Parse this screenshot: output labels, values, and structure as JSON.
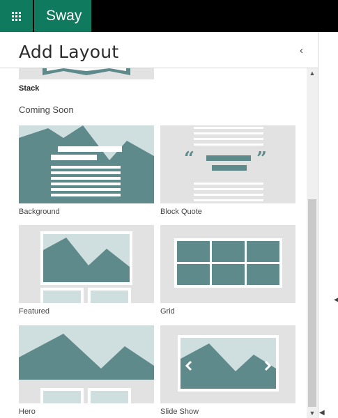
{
  "app": {
    "name": "Sway",
    "accent": "#0f7a5e"
  },
  "panel": {
    "title": "Add Layout",
    "collapse_icon": "‹"
  },
  "previous": {
    "label": "Stack"
  },
  "section": {
    "heading": "Coming Soon"
  },
  "layouts": [
    {
      "label": "Background",
      "icon": "background-layout-icon"
    },
    {
      "label": "Block Quote",
      "icon": "block-quote-layout-icon"
    },
    {
      "label": "Featured",
      "icon": "featured-layout-icon"
    },
    {
      "label": "Grid",
      "icon": "grid-layout-icon"
    },
    {
      "label": "Hero",
      "icon": "hero-layout-icon"
    },
    {
      "label": "Slide Show",
      "icon": "slide-show-layout-icon"
    }
  ],
  "colors": {
    "thumb_bg": "#e2e2e2",
    "teal": "#5f8a8c",
    "sky": "#cfdfe0"
  }
}
